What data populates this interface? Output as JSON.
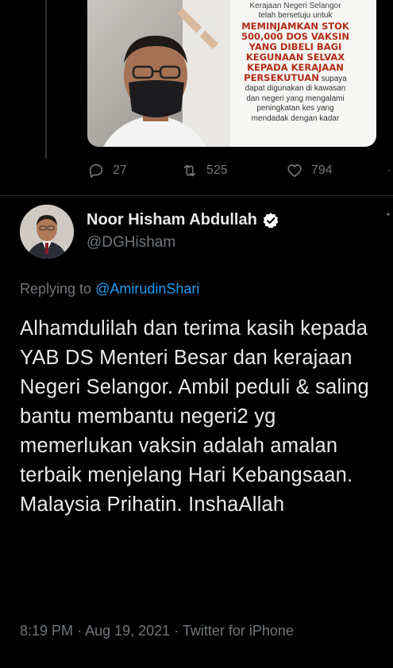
{
  "quoted_image": {
    "top_text": "Kerajaan Negeri Selangor",
    "text_1": "telah bersetuju untuk",
    "headline": [
      "MEMINJAMKAN STOK",
      "500,000 DOS VAKSIN",
      "YANG DIBELI BAGI",
      "KEGUNAAN SELVAX",
      "KEPADA KERAJAAN"
    ],
    "headline_last": "PERSEKUTUAN",
    "text_after": " supaya",
    "rest": [
      "dapat digunakan di kawasan",
      "dan negeri yang mengalami",
      "peningkatan kes yang",
      "mendadak dengan kadar"
    ]
  },
  "actions": {
    "replies": "27",
    "retweets": "525",
    "likes": "794"
  },
  "tweet": {
    "author_name": "Noor Hisham Abdullah",
    "handle": "@DGHisham",
    "replying_prefix": "Replying to ",
    "replying_to": "@AmirudinShari",
    "text": "Alhamdulilah dan terima kasih kepada YAB DS Menteri Besar dan kerajaan Negeri Selangor. Ambil peduli & saling bantu membantu negeri2 yg memerlukan vaksin adalah amalan terbaik menjelang Hari Kebangsaan. Malaysia Prihatin. InshaAllah",
    "time": "8:19 PM",
    "date": "Aug 19, 2021",
    "source": "Twitter for iPhone",
    "separator": "·"
  },
  "colors": {
    "background": "#000000",
    "text": "#e7e9ea",
    "secondary": "#71767b",
    "link": "#1d9bf0",
    "headline_red": "#b22c17"
  },
  "icons": [
    "reply-icon",
    "retweet-icon",
    "like-icon",
    "verified-badge-icon",
    "more-icon"
  ]
}
